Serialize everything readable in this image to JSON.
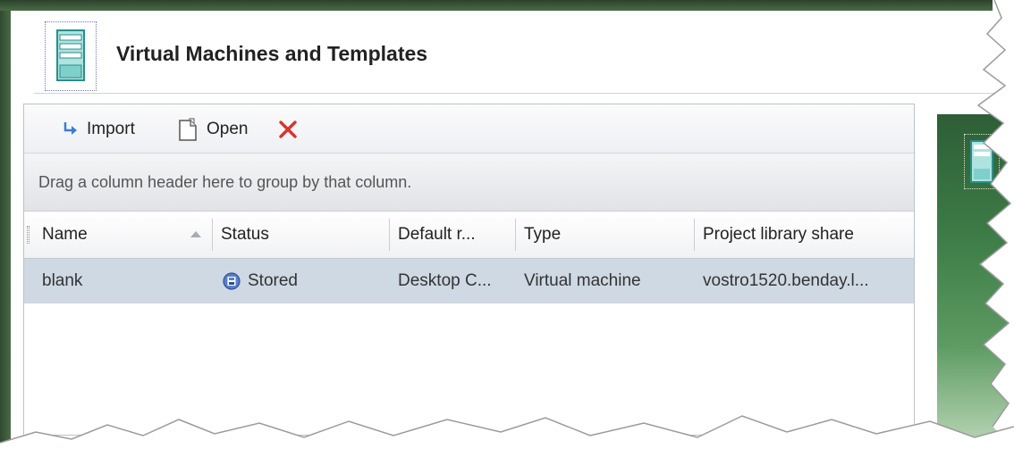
{
  "window": {
    "title": "Virtual Machines and Templates"
  },
  "toolbar": {
    "import_label": "Import",
    "open_label": "Open"
  },
  "grid": {
    "group_hint": "Drag a column header here to group by that column.",
    "columns": [
      "Name",
      "Status",
      "Default r...",
      "Type",
      "Project library share"
    ],
    "rows": [
      {
        "name": "blank",
        "status": "Stored",
        "default_r": "Desktop C...",
        "type": "Virtual machine",
        "share": "vostro1520.benday.l..."
      }
    ]
  },
  "colors": {
    "frame_green": "#3c5c3a",
    "row_selected": "#cfd9e4",
    "delete_red": "#d9342b",
    "import_arrow": "#3a7fd0"
  },
  "icons": [
    "vm-server-icon",
    "import-arrow-icon",
    "open-document-icon",
    "delete-x-icon",
    "stored-status-icon",
    "sort-ascending-icon"
  ]
}
